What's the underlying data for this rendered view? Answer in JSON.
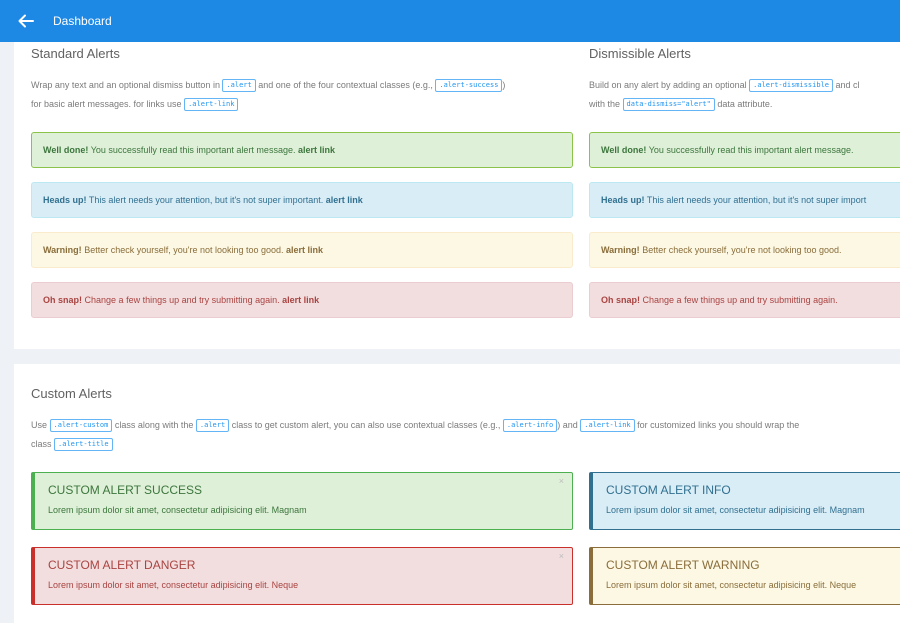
{
  "header": {
    "title": "Dashboard"
  },
  "standard": {
    "heading": "Standard Alerts",
    "desc1_a": "Wrap any text and an optional dismiss button in",
    "desc1_code1": ".alert",
    "desc1_b": "and one of the four contextual classes (e.g.,",
    "desc1_code2": ".alert-success",
    "desc1_c": ")",
    "desc2_a": "for basic alert messages. for links use",
    "desc2_code": ".alert-link",
    "alerts": [
      {
        "strong": "Well done!",
        "text": "You successfully read this important alert message.",
        "link": "alert link"
      },
      {
        "strong": "Heads up!",
        "text": "This alert needs your attention, but it's not super important.",
        "link": "alert link"
      },
      {
        "strong": "Warning!",
        "text": "Better check yourself, you're not looking too good.",
        "link": "alert link"
      },
      {
        "strong": "Oh snap!",
        "text": "Change a few things up and try submitting again.",
        "link": "alert link"
      }
    ]
  },
  "dismissible": {
    "heading": "Dismissible Alerts",
    "desc1_a": "Build on any alert by adding an optional",
    "desc1_code": ".alert-dismissible",
    "desc1_b": "and cl",
    "desc2_a": "with the",
    "desc2_code": "data-dismiss=\"alert\"",
    "desc2_b": "data attribute.",
    "alerts": [
      {
        "strong": "Well done!",
        "text": "You successfully read this important alert message."
      },
      {
        "strong": "Heads up!",
        "text": "This alert needs your attention, but it's not super import"
      },
      {
        "strong": "Warning!",
        "text": "Better check yourself, you're not looking too good."
      },
      {
        "strong": "Oh snap!",
        "text": "Change a few things up and try submitting again."
      }
    ]
  },
  "custom": {
    "heading": "Custom Alerts",
    "desc1_a": "Use",
    "desc1_code1": ".alert-custom",
    "desc1_b": "class along with the",
    "desc1_code2": ".alert",
    "desc1_c": "class to get custom alert, you can also use contextual classes (e.g.,",
    "desc1_code3": ".alert-info",
    "desc1_d": ") and",
    "desc1_code4": ".alert-link",
    "desc1_e": "for customized links you should wrap the",
    "desc2_a": "class",
    "desc2_code": ".alert-title",
    "close_glyph": "×",
    "boxes": [
      {
        "title": "CUSTOM ALERT SUCCESS",
        "text": "Lorem ipsum dolor sit amet, consectetur adipisicing elit. Magnam"
      },
      {
        "title": "CUSTOM ALERT INFO",
        "text": "Lorem ipsum dolor sit amet, consectetur adipisicing elit. Magnam"
      },
      {
        "title": "CUSTOM ALERT DANGER",
        "text": "Lorem ipsum dolor sit amet, consectetur adipisicing elit. Neque"
      },
      {
        "title": "CUSTOM ALERT WARNING",
        "text": "Lorem ipsum dolor sit amet, consectetur adipisicing elit. Neque"
      }
    ]
  },
  "colors": {
    "header": "#1e88e5",
    "success": "#dff0d8",
    "info": "#d9edf7",
    "warning": "#fcf8e3",
    "danger": "#f2dede"
  },
  "icons": {
    "back": "arrow-left-icon",
    "close": "close-icon"
  }
}
